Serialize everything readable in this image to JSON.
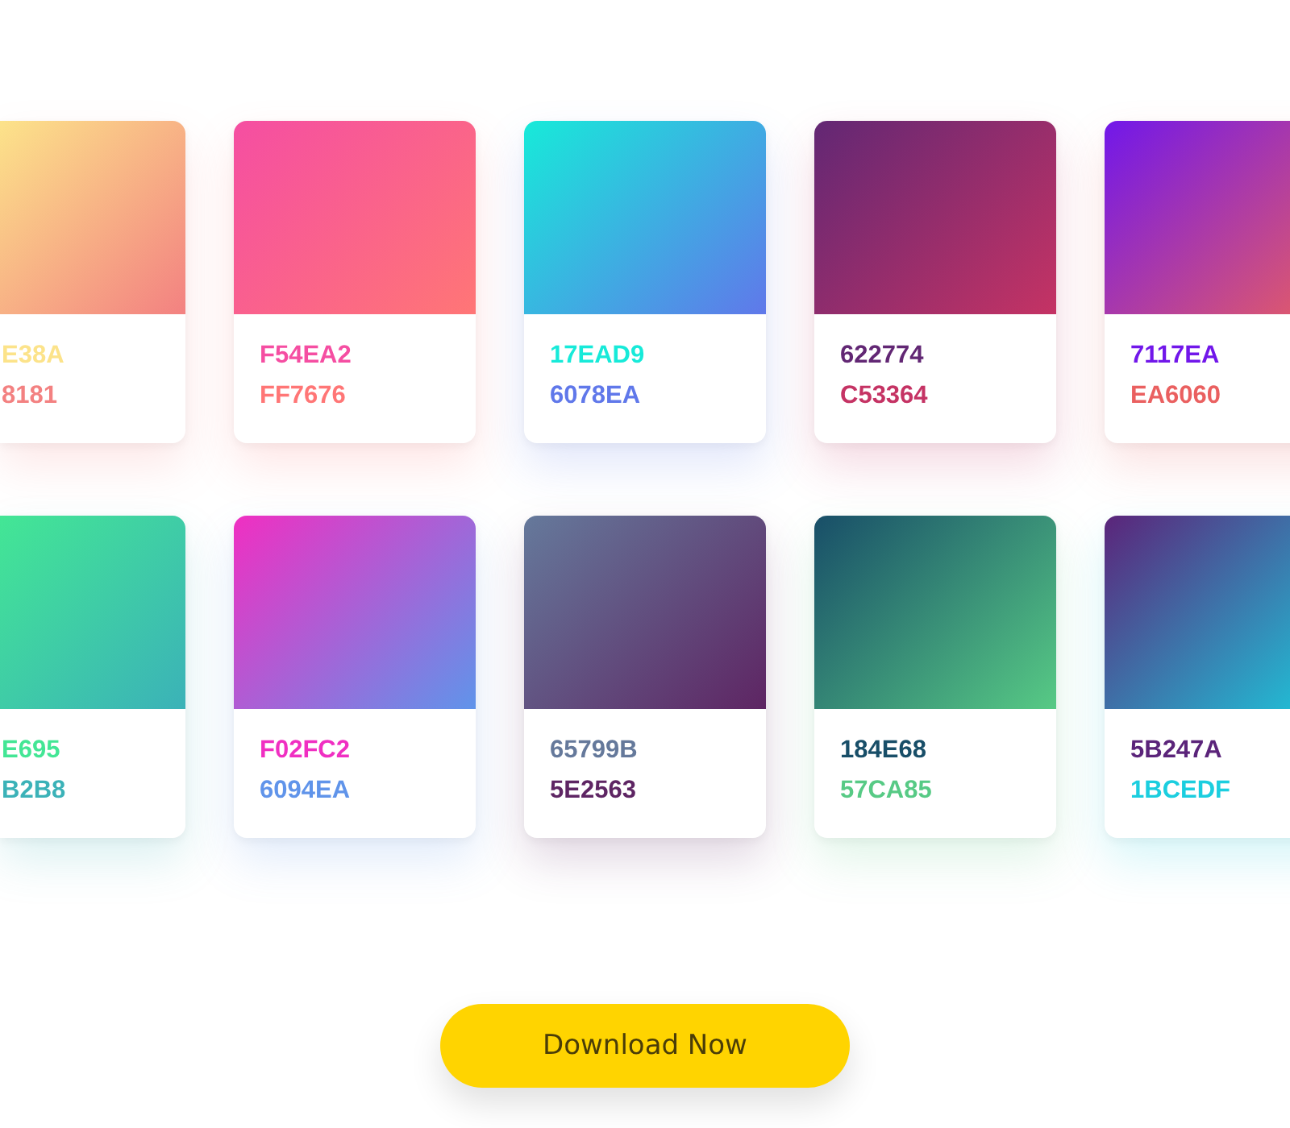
{
  "rows": [
    {
      "cards": [
        {
          "codes": [
            {
              "text": "E38A",
              "color": "#fce38a"
            },
            {
              "text": "8181",
              "color": "#f38181"
            }
          ]
        },
        {
          "codes": [
            {
              "text": "F54EA2",
              "color": "#f54ea2"
            },
            {
              "text": "FF7676",
              "color": "#ff7676"
            }
          ]
        },
        {
          "codes": [
            {
              "text": "17EAD9",
              "color": "#17ead9"
            },
            {
              "text": "6078EA",
              "color": "#6078ea"
            }
          ]
        },
        {
          "codes": [
            {
              "text": "622774",
              "color": "#622774"
            },
            {
              "text": "C53364",
              "color": "#c53364"
            }
          ]
        },
        {
          "codes": [
            {
              "text": "7117EA",
              "color": "#7117ea"
            },
            {
              "text": "EA6060",
              "color": "#ea6060"
            }
          ]
        }
      ]
    },
    {
      "cards": [
        {
          "codes": [
            {
              "text": "E695",
              "color": "#43e695"
            },
            {
              "text": "B2B8",
              "color": "#3bb2b8"
            }
          ]
        },
        {
          "codes": [
            {
              "text": "F02FC2",
              "color": "#f02fc2"
            },
            {
              "text": "6094EA",
              "color": "#6094ea"
            }
          ]
        },
        {
          "codes": [
            {
              "text": "65799B",
              "color": "#65799b"
            },
            {
              "text": "5E2563",
              "color": "#5e2563"
            }
          ]
        },
        {
          "codes": [
            {
              "text": "184E68",
              "color": "#184e68"
            },
            {
              "text": "57CA85",
              "color": "#57ca85"
            }
          ]
        },
        {
          "codes": [
            {
              "text": "5B247A",
              "color": "#5b247a"
            },
            {
              "text": "1BCEDF",
              "color": "#1bcedf"
            }
          ]
        }
      ]
    }
  ],
  "button": {
    "label": "Download Now"
  }
}
